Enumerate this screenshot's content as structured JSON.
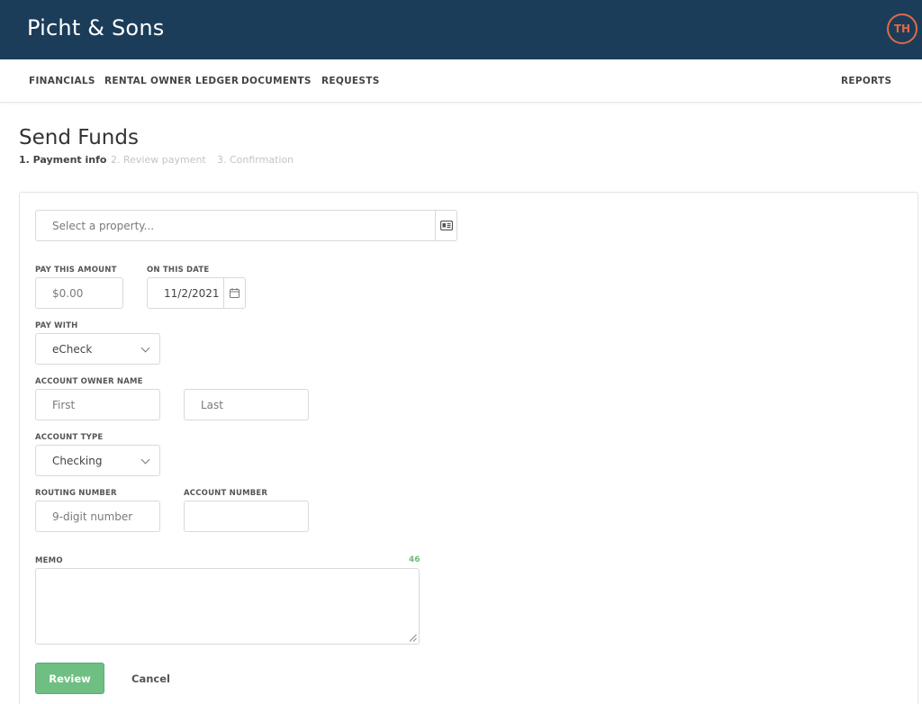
{
  "header": {
    "app_title": "Picht & Sons",
    "avatar_initials": "TH",
    "accent_color": "#1b3d5a",
    "avatar_color": "#e06a46"
  },
  "nav": {
    "financials": "FINANCIALS",
    "rental_owner_ledger": "RENTAL OWNER LEDGER",
    "documents": "DOCUMENTS",
    "requests": "REQUESTS",
    "reports": "REPORTS"
  },
  "page": {
    "title": "Send Funds",
    "steps": [
      "1. Payment info",
      "2. Review payment",
      "3. Confirmation"
    ],
    "active_step": 1
  },
  "form": {
    "property_placeholder": "Select a property...",
    "property_icon": "id-card-icon",
    "amount_label": "PAY THIS AMOUNT",
    "amount_value": "$0.00",
    "date_label": "ON THIS DATE",
    "date_value": "11/2/2021",
    "date_icon": "calendar-icon",
    "pay_with_label": "PAY WITH",
    "pay_with_value": "eCheck",
    "owner_name_label": "ACCOUNT OWNER NAME",
    "first_placeholder": "First",
    "last_placeholder": "Last",
    "account_type_label": "ACCOUNT TYPE",
    "account_type_value": "Checking",
    "routing_label": "ROUTING NUMBER",
    "routing_placeholder": "9-digit number",
    "account_number_label": "ACCOUNT NUMBER",
    "account_number_value": "",
    "memo_label": "MEMO",
    "memo_counter": "46",
    "memo_value": ""
  },
  "actions": {
    "review_label": "Review",
    "cancel_label": "Cancel",
    "review_color": "#6fbf83"
  }
}
